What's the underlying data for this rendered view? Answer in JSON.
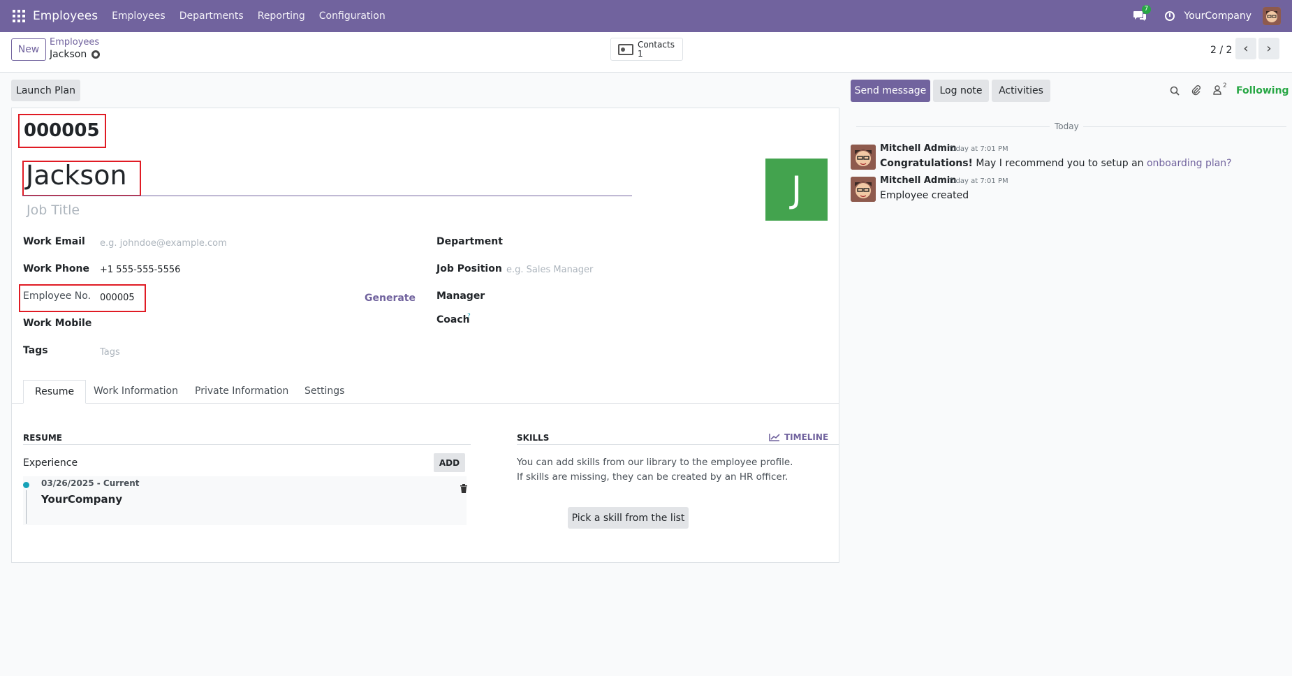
{
  "nav": {
    "brand": "Employees",
    "menu": [
      "Employees",
      "Departments",
      "Reporting",
      "Configuration"
    ],
    "chat_badge": "7",
    "company": "YourCompany"
  },
  "control": {
    "new_label": "New",
    "breadcrumb_parent": "Employees",
    "breadcrumb_current": "Jackson",
    "contacts_label": "Contacts",
    "contacts_count": "1",
    "pager": "2 / 2",
    "prev": "‹",
    "next": "›"
  },
  "form": {
    "launch_plan": "Launch Plan",
    "employee_id": "000005",
    "name": "Jackson",
    "job_title_placeholder": "Job Title",
    "avatar_letter": "J",
    "avatar_color": "#43a34e",
    "left_fields": [
      {
        "label": "Work Email",
        "value": "",
        "placeholder": "e.g. johndoe@example.com"
      },
      {
        "label": "Work Phone",
        "value": "+1 555-555-5556",
        "placeholder": ""
      },
      {
        "label": "Employee No.",
        "value": "000005",
        "placeholder": ""
      },
      {
        "label": "Work Mobile",
        "value": "",
        "placeholder": ""
      },
      {
        "label": "Tags",
        "value": "",
        "placeholder": "Tags"
      }
    ],
    "generate": "Generate",
    "right_fields": [
      {
        "label": "Department",
        "value": "",
        "placeholder": ""
      },
      {
        "label": "Job Position",
        "value": "",
        "placeholder": "e.g. Sales Manager"
      },
      {
        "label": "Manager",
        "value": "",
        "placeholder": ""
      },
      {
        "label": "Coach",
        "value": "",
        "placeholder": ""
      }
    ],
    "coach_help": "?",
    "tabs": [
      "Resume",
      "Work Information",
      "Private Information",
      "Settings"
    ],
    "resume_heading": "RESUME",
    "experience": "Experience",
    "add": "ADD",
    "exp_date": "03/26/2025 - Current",
    "exp_company": "YourCompany",
    "skills_heading": "SKILLS",
    "timeline": "TIMELINE",
    "skills_text1": "You can add skills from our library to the employee profile.",
    "skills_text2": "If skills are missing, they can be created by an HR officer.",
    "pick_skill": "Pick a skill from the list"
  },
  "chatter": {
    "send_message": "Send message",
    "log_note": "Log note",
    "activities": "Activities",
    "followers_count": "2",
    "following": "Following",
    "today": "Today",
    "messages": [
      {
        "author": "Mitchell Admin",
        "time": "Today at 7:01 PM",
        "bold": "Congratulations!",
        "text": " May I recommend you to setup an ",
        "link": "onboarding plan?"
      },
      {
        "author": "Mitchell Admin",
        "time": "Today at 7:01 PM",
        "bold": "",
        "text": "Employee created",
        "link": ""
      }
    ]
  },
  "colors": {
    "primary": "#71639e",
    "highlight": "#e01b24",
    "following": "#28a745",
    "dot": "#17a2b8"
  }
}
